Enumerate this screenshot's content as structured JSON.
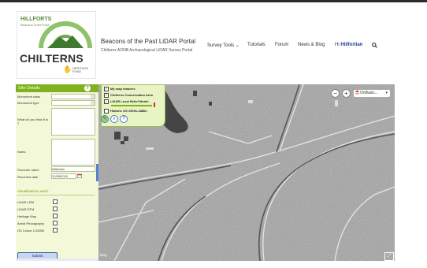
{
  "header": {
    "logo": {
      "line1": "HILLFORTS",
      "line2": "Beacons of the Past",
      "main": "CHILTERNS",
      "fund1": "HERITAGE",
      "fund2": "FUND"
    },
    "title": "Beacons of the Past LiDAR Portal",
    "subtitle": "Chilterns AONB Archaeological LiDAR Survey Portal"
  },
  "nav": {
    "items": [
      "Survey Tools",
      "Tutorials",
      "Forum",
      "News & Blog"
    ],
    "user_prefix": "Hi",
    "user_name": "Hillfortian",
    "search_icon": "search-icon"
  },
  "panel": {
    "title": "Site Details",
    "fields": {
      "monument_class": "Monument class",
      "monument_type": "Monument type",
      "what_think": "What do you think it is ?",
      "notes": "Notes",
      "recorder_name": "Recorder name",
      "recorder_name_value": "hillfortian",
      "recorded_date": "Recorded date",
      "recorded_date_value": "12/08/2019"
    },
    "visualisations_title": "Visualisations used :",
    "visualisations": [
      "LiDAR LRM",
      "LiDAR DTM",
      "Heritage Map",
      "Aerial Photography",
      "OS Colour 1:25000"
    ],
    "submit": "Submit"
  },
  "map": {
    "layers": [
      {
        "label": "My map features",
        "checked": true,
        "bold": true
      },
      {
        "label": "Chilterns Conservation Area",
        "checked": true,
        "bold": true
      },
      {
        "label": "LiDAR Local Relief Model",
        "checked": true,
        "bold": true
      },
      {
        "label": "Historic OS 1900s-1880s",
        "checked": false,
        "bold": true
      }
    ],
    "basemap": "OnBasic...",
    "attribution": "bing"
  },
  "colors": {
    "accent_green": "#7fb21e",
    "panel_bg": "#f3f8d9",
    "link_blue": "#1a3aa0"
  }
}
